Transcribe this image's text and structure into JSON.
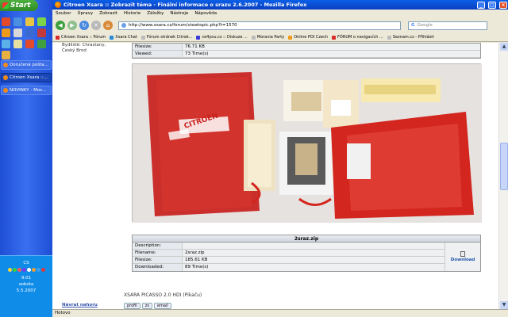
{
  "taskbar": {
    "start_label": "Start",
    "tasks": [
      {
        "label": "Doručená pošta..."
      },
      {
        "label": "Citroen Xsara ::..."
      },
      {
        "label": "NOVINKY - Mos..."
      }
    ],
    "tray": {
      "label": "CS",
      "time": "9:01",
      "day": "sobota",
      "date": "5.5.2007"
    }
  },
  "window": {
    "title": "Citroen Xsara :: Zobrazit téma - Finální informace o srazu 2.6.2007 - Mozilla Firefox",
    "menu": [
      "Soubor",
      "Úpravy",
      "Zobrazit",
      "Historie",
      "Záložky",
      "Nástroje",
      "Nápověda"
    ],
    "url": "http://www.xsara.cz/forum/viewtopic.php?t=1570",
    "search_placeholder": "Google",
    "bookmarks": [
      "Citroen Xsara :: Fórum",
      "Xsara Chat",
      "Fórum stránek Citroë...",
      "ce4you.cz :: Diskuze ...",
      "Moravia Party",
      "Online POI Czech",
      "FÓRUM o navigacích ...",
      "Seznam.cz - Přihlásit"
    ],
    "status": "Hotovo"
  },
  "page": {
    "profile": {
      "line1": "Bydliště: Chrastany,",
      "line2": "Český Brod"
    },
    "attachment1": {
      "rows": [
        {
          "key": "Filesize:",
          "value": "76.71 KB"
        },
        {
          "key": "Viewed:",
          "value": "73 Time(s)"
        }
      ],
      "photo_caption": "CITROËN"
    },
    "attachment2": {
      "name": "2sraz.zip",
      "rows": [
        {
          "key": "Description:",
          "value": ""
        },
        {
          "key": "Filename:",
          "value": "2sraz.zip"
        },
        {
          "key": "Filesize:",
          "value": "185.61 KB"
        },
        {
          "key": "Downloaded:",
          "value": "89 Time(s)"
        }
      ],
      "download_label": "Download"
    },
    "signature": "XSARA PICASSO 2.0 HDI (Pikaču)",
    "nav_link": "Návrat nahoru",
    "post_buttons": [
      "profil",
      "zs",
      "email"
    ]
  }
}
